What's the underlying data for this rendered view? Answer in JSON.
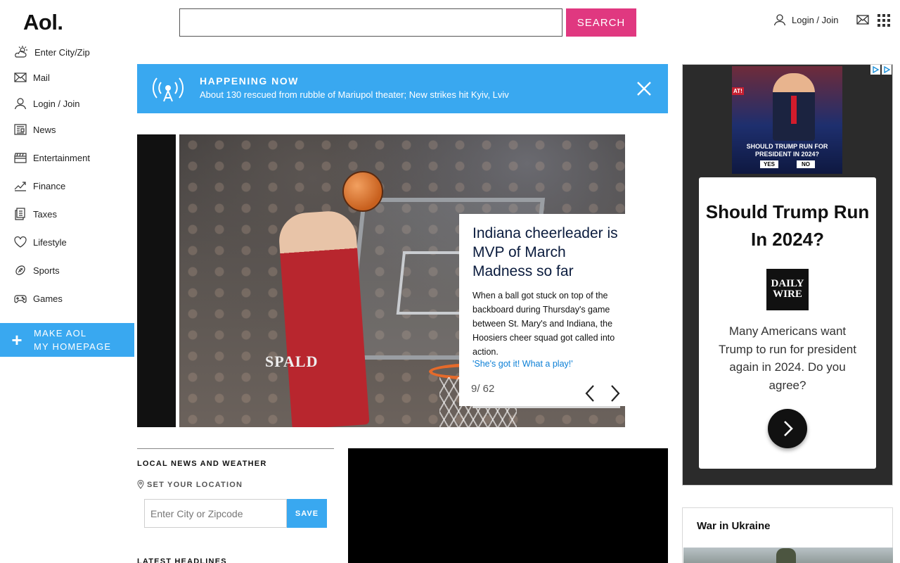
{
  "header": {
    "logo": "Aol.",
    "search_placeholder": "",
    "search_button": "SEARCH",
    "login_label": "Login / Join"
  },
  "sidebar": {
    "items": [
      {
        "label": "Enter City/Zip",
        "icon": "weather-icon"
      },
      {
        "label": "Mail",
        "icon": "mail-icon"
      },
      {
        "label": "Login / Join",
        "icon": "user-icon"
      },
      {
        "label": "News",
        "icon": "news-icon"
      },
      {
        "label": "Entertainment",
        "icon": "clapper-icon"
      },
      {
        "label": "Finance",
        "icon": "chart-icon"
      },
      {
        "label": "Taxes",
        "icon": "documents-icon"
      },
      {
        "label": "Lifestyle",
        "icon": "heart-icon"
      },
      {
        "label": "Sports",
        "icon": "ball-icon"
      },
      {
        "label": "Games",
        "icon": "gamepad-icon"
      }
    ],
    "homepage_line1": "MAKE AOL",
    "homepage_line2": "MY HOMEPAGE"
  },
  "banner": {
    "title": "HAPPENING NOW",
    "text": "About 130 rescued from rubble of Mariupol theater; New strikes hit Kyiv, Lviv"
  },
  "carousel": {
    "title": "Indiana cheerleader is MVP of March Madness so far",
    "description": "When a ball got stuck on top of the backboard during Thursday's game between St. Mary's and Indiana, the Hoosiers cheer squad got called into action.",
    "link": "'She's got it! What a play!'",
    "counter": "9/ 62",
    "image_text": "SPALD"
  },
  "local": {
    "title": "LOCAL NEWS AND WEATHER",
    "set_location": "SET YOUR LOCATION",
    "zip_placeholder": "Enter City or Zipcode",
    "save": "SAVE",
    "latest": "LATEST HEADLINES"
  },
  "ad": {
    "img_tag": "AT!",
    "img_question": "SHOULD TRUMP RUN FOR PRESIDENT IN 2024?",
    "img_yes": "YES",
    "img_no": "NO",
    "title": "Should Trump Run In 2024?",
    "logo_line1": "DAILY",
    "logo_line2": "WIRE",
    "body": "Many Americans want Trump to run for president again in 2024. Do you agree?"
  },
  "war": {
    "title": "War in Ukraine"
  },
  "colors": {
    "accent_blue": "#39a8f0",
    "search_pink": "#e03880",
    "link_blue": "#0b7fd6"
  }
}
